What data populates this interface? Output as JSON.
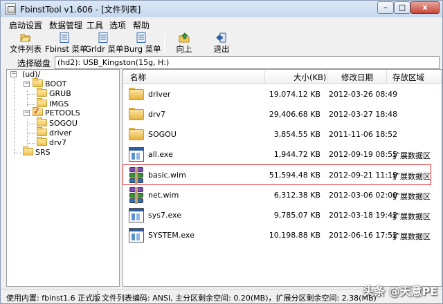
{
  "window": {
    "title": "FbinstTool v1.606 - [文件列表]",
    "controls": {
      "minimize": "–",
      "maximize": "□",
      "close": "x"
    }
  },
  "menu": [
    "启动设置",
    "数据管理",
    "工具",
    "选项",
    "帮助"
  ],
  "toolbar": {
    "buttons": [
      {
        "label": "文件列表",
        "icon": "folder-open-icon"
      },
      {
        "label": "Fbinst 菜单",
        "icon": "menu-doc-icon"
      },
      {
        "label": "Grldr 菜单",
        "icon": "menu-doc-icon"
      },
      {
        "label": "Burg 菜单",
        "icon": "menu-doc-icon"
      },
      {
        "label": "向上",
        "icon": "up-arrow-icon"
      },
      {
        "label": "退出",
        "icon": "exit-icon"
      }
    ]
  },
  "disk_selector": {
    "label": "选择磁盘",
    "value": "(hd2): USB_Kingston(15g, H:)"
  },
  "tree": {
    "root": "(ud)/",
    "boot": "BOOT",
    "boot_children": [
      "GRUB",
      "IMGS"
    ],
    "petools": "PETOOLS",
    "petools_children": [
      "SOGOU",
      "driver",
      "drv7"
    ],
    "srs": "SRS"
  },
  "list": {
    "columns": {
      "name": "名称",
      "size": "大小(KB)",
      "modified": "修改日期",
      "area": "存放区域"
    },
    "rows": [
      {
        "name": "driver",
        "size": "19,074.12 KB",
        "modified": "2012-03-26 08:49",
        "area": "",
        "icon": "folder-icon"
      },
      {
        "name": "drv7",
        "size": "29,406.68 KB",
        "modified": "2012-03-27 18:48",
        "area": "",
        "icon": "folder-icon"
      },
      {
        "name": "SOGOU",
        "size": "3,854.55 KB",
        "modified": "2011-11-06 18:52",
        "area": "",
        "icon": "folder-icon"
      },
      {
        "name": "all.exe",
        "size": "1,944.72 KB",
        "modified": "2012-09-19 08:55",
        "area": "扩展数据区",
        "icon": "exe-icon"
      },
      {
        "name": "basic.wim",
        "size": "51,594.48 KB",
        "modified": "2012-09-21 11:19",
        "area": "扩展数据区",
        "icon": "archive-icon"
      },
      {
        "name": "net.wim",
        "size": "6,312.38 KB",
        "modified": "2012-03-06 02:00",
        "area": "扩展数据区",
        "icon": "archive-icon"
      },
      {
        "name": "sys7.exe",
        "size": "9,785.07 KB",
        "modified": "2012-03-18 19:42",
        "area": "扩展数据区",
        "icon": "exe-icon"
      },
      {
        "name": "SYSTEM.exe",
        "size": "10,198.88 KB",
        "modified": "2012-06-16 17:52",
        "area": "扩展数据区",
        "icon": "exe-icon"
      }
    ]
  },
  "status": {
    "kernel": "使用内置: fbinst1.6 正式版",
    "info": "文件列表编码: ANSI, 主分区剩余空间: 0.20(MB)，扩展分区剩余空间: 2.38(MB)"
  },
  "watermark": "头条 @天意PE",
  "colors": {
    "highlight_border": "#e02020",
    "check_mark": "#d0201a"
  }
}
